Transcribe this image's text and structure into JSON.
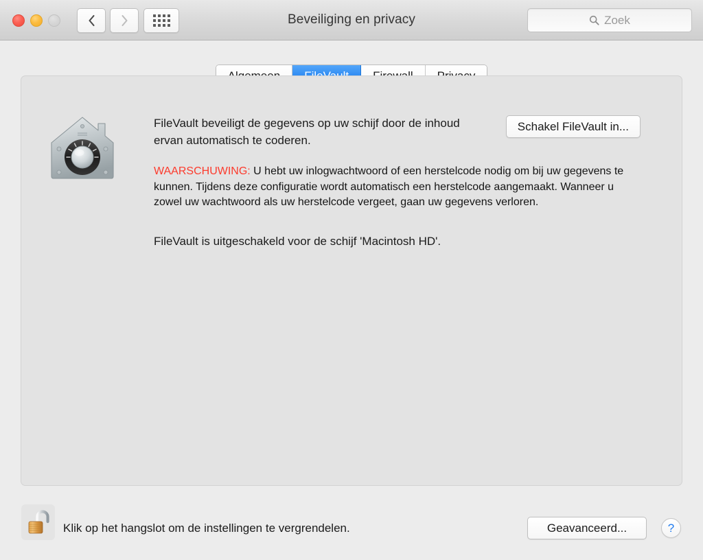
{
  "window": {
    "title": "Beveiliging en privacy",
    "traffic_lights": [
      {
        "name": "close",
        "color": "#fb6054"
      },
      {
        "name": "minimize",
        "color": "#fcbc40"
      },
      {
        "name": "zoom",
        "color": "#d6d6d6"
      }
    ],
    "nav": {
      "back_label": "‹",
      "forward_label": "›",
      "show_all_label": "show-all-grid"
    }
  },
  "search": {
    "placeholder": "Zoek",
    "value": "",
    "icon": "search-icon"
  },
  "tabs": [
    {
      "label": "Algemeen",
      "selected": false
    },
    {
      "label": "FileVault",
      "selected": true
    },
    {
      "label": "Firewall",
      "selected": false
    },
    {
      "label": "Privacy",
      "selected": false
    }
  ],
  "main": {
    "icon": "filevault-safe-icon",
    "intro": "FileVault beveiligt de gegevens op uw schijf door de inhoud ervan automatisch te coderen.",
    "enable_button": "Schakel FileVault in...",
    "warning_label": "WAARSCHUWING:",
    "warning_text": " U hebt uw inlogwachtwoord of een herstelcode nodig om bij uw gegevens te kunnen. Tijdens deze configuratie wordt automatisch een herstelcode aangemaakt. Wanneer u zowel uw wachtwoord als uw herstelcode vergeet, gaan uw gegevens verloren.",
    "status": "FileVault is uitgeschakeld voor de schijf 'Macintosh HD'."
  },
  "footer": {
    "lock_icon": "padlock-open-icon",
    "lock_hint": "Klik op het hangslot om de instellingen te vergrendelen.",
    "advanced_button": "Geavanceerd...",
    "help_button": "?"
  },
  "colors": {
    "accent": "#2f8bf2",
    "warning": "#fc3b2d",
    "help": "#1f7bf0",
    "window_bg": "#ececec",
    "panel_bg": "#e3e3e3"
  }
}
